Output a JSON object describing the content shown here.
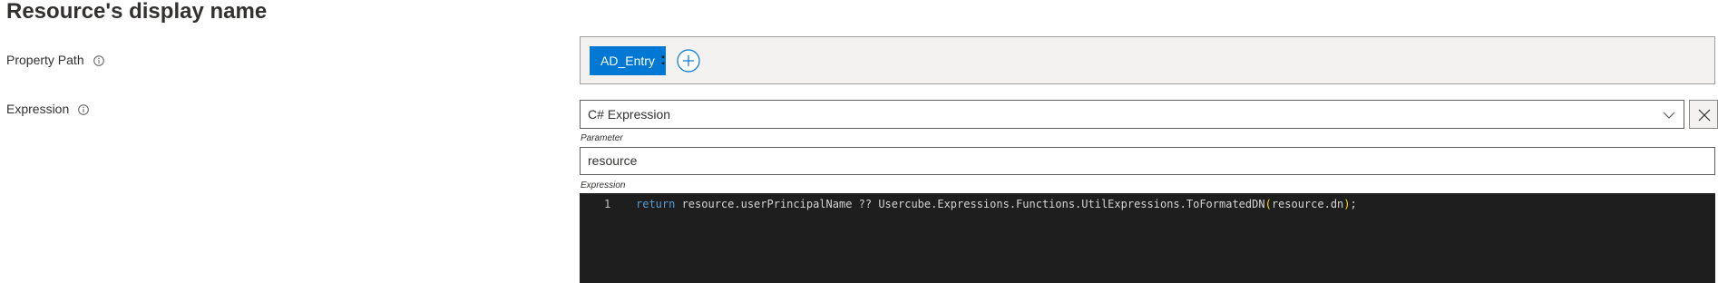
{
  "section": {
    "title": "Resource's display name"
  },
  "property_path": {
    "label": "Property Path",
    "chip": "AD_Entry",
    "separator": ":"
  },
  "expression": {
    "label": "Expression",
    "type_value": "C# Expression",
    "parameter_label": "Parameter",
    "parameter_value": "resource",
    "editor_label": "Expression",
    "line_number": "1",
    "code_keyword": "return",
    "code_before_paren": " resource.userPrincipalName ?? Usercube.Expressions.Functions.UtilExpressions.ToFormatedDN",
    "code_open_paren": "(",
    "code_args": "resource.dn",
    "code_close_paren": ")",
    "code_end": ";"
  },
  "icons": {
    "info": "info-icon",
    "add": "add-circle-icon",
    "chevron": "chevron-down-icon",
    "clear": "close-icon"
  },
  "colors": {
    "accent": "#0078d4",
    "editor_bg": "#1e1e1e",
    "keyword": "#569cd6"
  }
}
